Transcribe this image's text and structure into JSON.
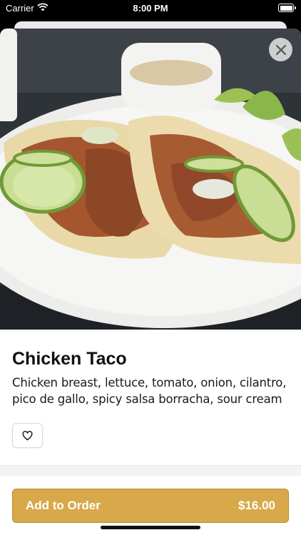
{
  "status_bar": {
    "carrier": "Carrier",
    "time": "8:00 PM"
  },
  "item": {
    "title": "Chicken Taco",
    "description": "Chicken breast, lettuce, tomato, onion, cilantro, pico de gallo, spicy salsa borracha, sour cream",
    "image_alt": "Chicken taco plate photo"
  },
  "actions": {
    "add_label": "Add to Order",
    "price": "$16.00"
  },
  "colors": {
    "accent": "#d8a94a",
    "accent_border": "#b98a2e"
  },
  "icons": {
    "close": "close-icon",
    "favorite": "heart-outline-icon",
    "wifi": "wifi-icon",
    "battery": "battery-icon"
  }
}
